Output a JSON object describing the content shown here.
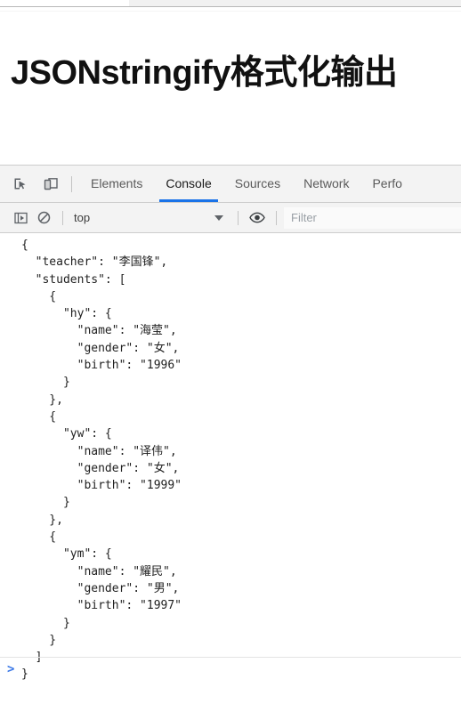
{
  "browser": {
    "tab_strip_visible": true
  },
  "page": {
    "title": "JSONstringify格式化输出"
  },
  "devtools": {
    "toolbar_icons": [
      {
        "name": "inspect-element-icon",
        "label": "Inspect element"
      },
      {
        "name": "device-toolbar-icon",
        "label": "Toggle device toolbar"
      }
    ],
    "tabs": [
      {
        "label": "Elements",
        "active": false
      },
      {
        "label": "Console",
        "active": true
      },
      {
        "label": "Sources",
        "active": false
      },
      {
        "label": "Network",
        "active": false
      },
      {
        "label": "Perfo",
        "active": false
      }
    ],
    "active_tab": "Console",
    "accent_color": "#1a73e8",
    "filter_bar": {
      "sidebar_toggle_label": "Show console sidebar",
      "clear_console_label": "Clear console",
      "context_selected": "top",
      "eye_label": "Create live expression",
      "filter_placeholder": "Filter",
      "filter_value": ""
    },
    "console": {
      "prompt_symbol": ">",
      "prompt_color": "#3b78e7",
      "output": "{\n  \"teacher\": \"李国锋\",\n  \"students\": [\n    {\n      \"hy\": {\n        \"name\": \"海莹\",\n        \"gender\": \"女\",\n        \"birth\": \"1996\"\n      }\n    },\n    {\n      \"yw\": {\n        \"name\": \"译伟\",\n        \"gender\": \"女\",\n        \"birth\": \"1999\"\n      }\n    },\n    {\n      \"ym\": {\n        \"name\": \"耀民\",\n        \"gender\": \"男\",\n        \"birth\": \"1997\"\n      }\n    }\n  ]\n}",
      "data": {
        "teacher": "李国锋",
        "students": [
          {
            "hy": {
              "name": "海莹",
              "gender": "女",
              "birth": "1996"
            }
          },
          {
            "yw": {
              "name": "译伟",
              "gender": "女",
              "birth": "1999"
            }
          },
          {
            "ym": {
              "name": "耀民",
              "gender": "男",
              "birth": "1997"
            }
          }
        ]
      }
    }
  }
}
